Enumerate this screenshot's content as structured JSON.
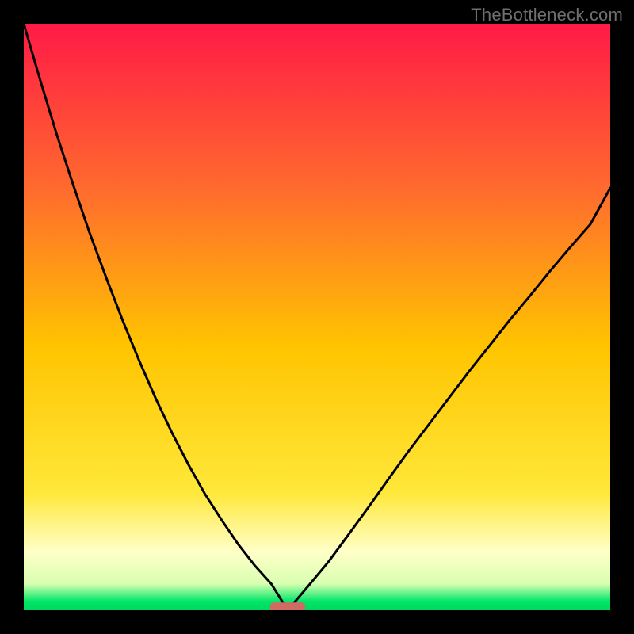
{
  "watermark": {
    "text": "TheBottleneck.com"
  },
  "colors": {
    "black": "#000000",
    "curve": "#000000",
    "marker_fill": "#cf6b63",
    "grad_top": "#ff1a46",
    "grad_mid_upper": "#ff8a2b",
    "grad_mid": "#ffd400",
    "grad_pale": "#ffffc0",
    "grad_green": "#00e668"
  },
  "chart_data": {
    "type": "line",
    "title": "",
    "xlabel": "",
    "ylabel": "",
    "xlim": [
      0,
      100
    ],
    "ylim": [
      0,
      100
    ],
    "grid": false,
    "legend": false,
    "annotations": [],
    "min_x": 45,
    "marker": {
      "x_center": 45,
      "width": 6,
      "y": 0.5,
      "rx": 2.2
    },
    "series": [
      {
        "name": "left-curve",
        "comment": "x from 0 to ~45; y≈100 at x=0 dropping to 0 at minimum",
        "x": [
          0.0,
          2.8,
          5.6,
          8.4,
          11.2,
          14.1,
          16.9,
          19.7,
          22.5,
          25.3,
          28.1,
          30.9,
          33.8,
          36.6,
          39.4,
          42.2,
          45.0
        ],
        "y": [
          100.0,
          90.4,
          81.2,
          72.6,
          64.4,
          56.6,
          49.3,
          42.5,
          36.1,
          30.2,
          24.8,
          19.8,
          15.3,
          11.2,
          7.6,
          4.5,
          0.0
        ]
      },
      {
        "name": "right-curve",
        "comment": "x from ~45 to 100; y rises from 0 to ~72 at x=100",
        "x": [
          45.0,
          48.4,
          51.9,
          55.3,
          58.8,
          62.2,
          65.6,
          69.1,
          72.5,
          75.9,
          79.4,
          82.8,
          86.3,
          89.7,
          93.1,
          96.6,
          100.0
        ],
        "y": [
          0.0,
          4.0,
          8.2,
          12.8,
          17.6,
          22.4,
          27.1,
          31.7,
          36.2,
          40.7,
          45.1,
          49.4,
          53.6,
          57.8,
          61.8,
          65.8,
          72.0
        ]
      }
    ],
    "background_gradient": {
      "direction": "vertical",
      "stops": [
        {
          "offset": 0.0,
          "color": "#ff1a46"
        },
        {
          "offset": 0.28,
          "color": "#ff6a2e"
        },
        {
          "offset": 0.55,
          "color": "#ffc400"
        },
        {
          "offset": 0.8,
          "color": "#ffe83a"
        },
        {
          "offset": 0.9,
          "color": "#ffffc8"
        },
        {
          "offset": 0.955,
          "color": "#d8ffb0"
        },
        {
          "offset": 0.985,
          "color": "#00e668"
        },
        {
          "offset": 1.0,
          "color": "#00d85e"
        }
      ]
    }
  }
}
